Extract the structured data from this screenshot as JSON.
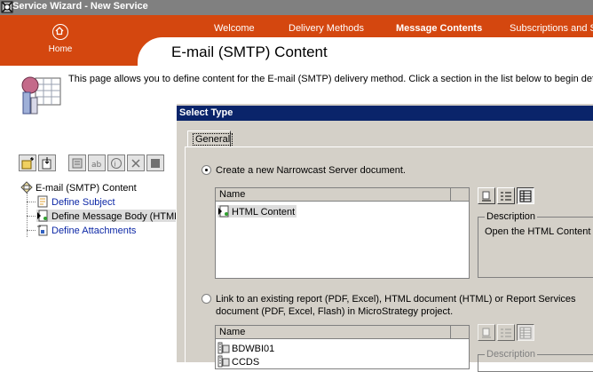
{
  "window": {
    "title": "Service Wizard - New Service"
  },
  "header": {
    "home_label": "Home",
    "nav": [
      {
        "label": "Welcome",
        "active": false
      },
      {
        "label": "Delivery Methods",
        "active": false
      },
      {
        "label": "Message Contents",
        "active": true
      },
      {
        "label": "Subscriptions and S",
        "active": false
      }
    ],
    "page_title": "E-mail (SMTP) Content"
  },
  "intro": {
    "text": "This page allows you to define content for the E-mail (SMTP) delivery method.  Click a section in the list below to begin defining"
  },
  "toolbar": {
    "buttons": [
      {
        "icon": "new-folder-icon"
      },
      {
        "icon": "import-icon"
      },
      {
        "icon": "properties-icon"
      },
      {
        "icon": "rename-icon"
      },
      {
        "icon": "help-icon"
      },
      {
        "icon": "delete-icon"
      },
      {
        "icon": "stop-icon"
      }
    ]
  },
  "tree": {
    "root": "E-mail (SMTP) Content",
    "children": [
      {
        "label": "Define Subject",
        "selected": false
      },
      {
        "label": "Define Message Body (HTML",
        "selected": true
      },
      {
        "label": "Define Attachments",
        "selected": false
      }
    ]
  },
  "dialog": {
    "title": "Select Type",
    "tab": "General",
    "option1": {
      "label": "Create a new Narrowcast Server document.",
      "selected": true,
      "list_header": "Name",
      "items": [
        "HTML Content"
      ],
      "description_label": "Description",
      "description_text": "Open the HTML Content E"
    },
    "option2": {
      "label_line1": "Link to an existing report (PDF, Excel), HTML document (HTML) or Report Services",
      "label_line2": "document (PDF, Excel, Flash) in MicroStrategy project.",
      "selected": false,
      "list_header": "Name",
      "items": [
        "BDWBI01",
        "CCDS"
      ],
      "description_label": "Description"
    }
  }
}
